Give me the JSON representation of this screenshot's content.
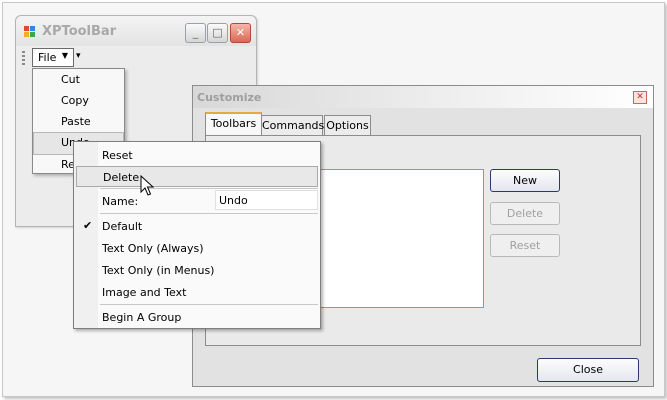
{
  "xptoolbar": {
    "title": "XPToolBar",
    "file_menu_label": "File",
    "file_menu_items": [
      "Cut",
      "Copy",
      "Paste",
      "Undo",
      "Re"
    ]
  },
  "customize": {
    "title": "Customize",
    "tabs": [
      "Toolbars",
      "Commands",
      "Options"
    ],
    "active_tab": "Toolbars",
    "buttons": {
      "new": "New",
      "delete": "Delete",
      "reset": "Reset"
    },
    "close_label": "Close"
  },
  "context_menu": {
    "reset": "Reset",
    "delete": "Delete",
    "name_label": "Name:",
    "name_value": "Undo",
    "default": "Default",
    "text_only_always": "Text Only (Always)",
    "text_only_menus": "Text Only (in Menus)",
    "image_and_text": "Image and Text",
    "begin_group": "Begin A Group",
    "checked_item": "Default"
  },
  "colors": {
    "accent_tab": "#e8a840",
    "close_red": "#d76a55",
    "list_border": "#7f9db9"
  }
}
